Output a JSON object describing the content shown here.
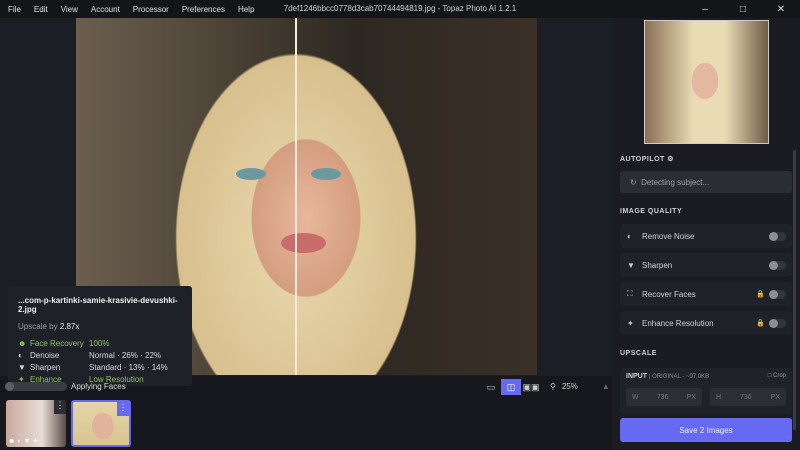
{
  "menubar": {
    "items": [
      "File",
      "Edit",
      "View",
      "Account",
      "Processor",
      "Preferences",
      "Help"
    ],
    "title": "7def1246bbcc0778d3cab70744494819.jpg - Topaz Photo AI 1.2.1"
  },
  "info": {
    "filename": "...com-p-kartinki-samie-krasivie-devushki-2.jpg",
    "upscale_label": "Upscale by",
    "upscale_value": "2.87x",
    "rows": [
      {
        "label": "Face Recovery",
        "value": "100%"
      },
      {
        "label": "Denoise",
        "value": "Normal · 26% · 22%"
      },
      {
        "label": "Sharpen",
        "value": "Standard · 13% · 14%"
      },
      {
        "label": "Enhance",
        "value": "Low Resolution"
      }
    ]
  },
  "status": {
    "label": "Applying Faces",
    "progress": 0.0
  },
  "zoom": {
    "value": "25%"
  },
  "panel": {
    "autopilot": "AUTOPILOT",
    "detecting": "Detecting subject...",
    "image_quality": "IMAGE QUALITY",
    "options": [
      {
        "label": "Remove Noise"
      },
      {
        "label": "Sharpen"
      },
      {
        "label": "Recover Faces"
      },
      {
        "label": "Enhance Resolution"
      }
    ],
    "upscale": "UPSCALE",
    "input": "INPUT",
    "input_meta": "| ORIGINAL - ~97,0KB",
    "crop": "Crop",
    "w_label": "W",
    "w_value": "736",
    "h_label": "H",
    "h_value": "736",
    "unit": "PX",
    "save": "Save 2 Images"
  },
  "colors": {
    "accent": "#6669f2",
    "green": "#8cc560"
  }
}
